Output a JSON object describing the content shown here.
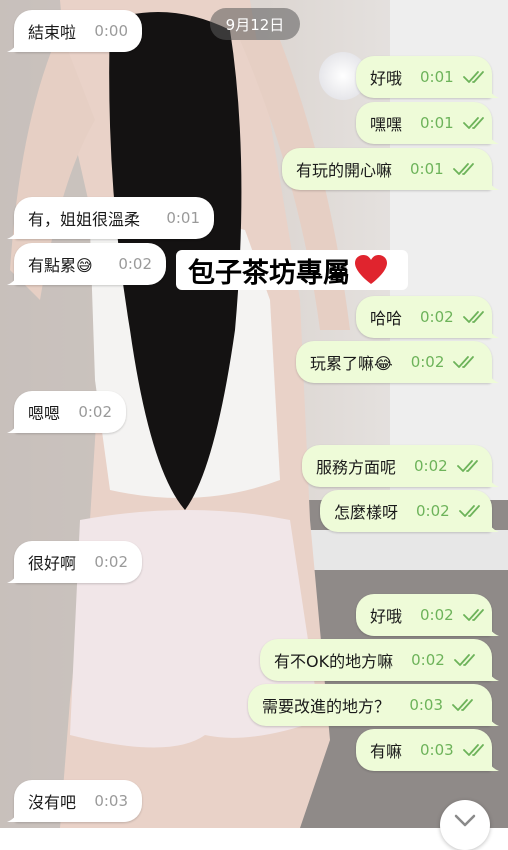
{
  "date_divider": "9月12日",
  "watermark": {
    "text": "包子茶坊專屬",
    "heart_icon": "red-heart-emoji"
  },
  "colors": {
    "incoming_bubble": "#ffffff",
    "outgoing_bubble": "#eefbd8",
    "read_ticks": "#6db35a"
  },
  "messages": [
    {
      "dir": "in",
      "text": "結束啦",
      "time": "0:00"
    },
    {
      "dir": "out",
      "text": "好哦",
      "time": "0:01",
      "status": "read"
    },
    {
      "dir": "out",
      "text": "嘿嘿",
      "time": "0:01",
      "status": "read"
    },
    {
      "dir": "out",
      "text": "有玩的開心嘛",
      "time": "0:01",
      "status": "read"
    },
    {
      "dir": "in",
      "text": "有，姐姐很溫柔",
      "time": "0:01"
    },
    {
      "dir": "in",
      "text": "有點累😅",
      "time": "0:02"
    },
    {
      "dir": "out",
      "text": "哈哈",
      "time": "0:02",
      "status": "read"
    },
    {
      "dir": "out",
      "text": "玩累了嘛😂",
      "time": "0:02",
      "status": "read"
    },
    {
      "dir": "in",
      "text": "嗯嗯",
      "time": "0:02"
    },
    {
      "dir": "out",
      "text": "服務方面呢",
      "time": "0:02",
      "status": "read"
    },
    {
      "dir": "out",
      "text": "怎麼樣呀",
      "time": "0:02",
      "status": "read"
    },
    {
      "dir": "in",
      "text": "很好啊",
      "time": "0:02"
    },
    {
      "dir": "out",
      "text": "好哦",
      "time": "0:02",
      "status": "read"
    },
    {
      "dir": "out",
      "text": "有不OK的地方嘛",
      "time": "0:02",
      "status": "read"
    },
    {
      "dir": "out",
      "text": "需要改進的地方？",
      "time": "0:03",
      "status": "read"
    },
    {
      "dir": "out",
      "text": "有嘛",
      "time": "0:03",
      "status": "read"
    },
    {
      "dir": "in",
      "text": "沒有吧",
      "time": "0:03"
    }
  ],
  "scroll_button": {
    "icon": "chevron-down-icon"
  }
}
